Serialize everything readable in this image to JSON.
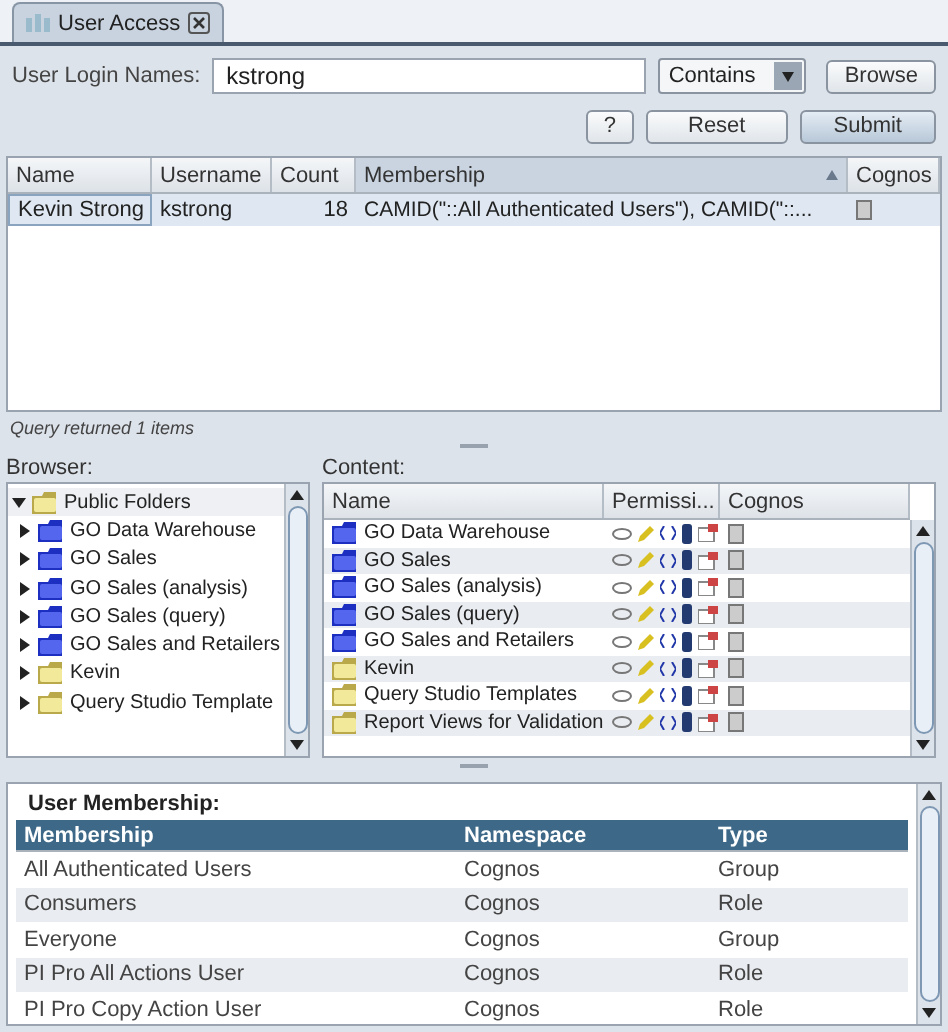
{
  "tabs": [
    {
      "label": "User Access",
      "selected": true
    }
  ],
  "search": {
    "label": "User Login Names:",
    "value": "kstrong",
    "match": "Contains",
    "browse": "Browse"
  },
  "actions": [
    "?",
    "Reset",
    "Submit"
  ],
  "results": {
    "columns": [
      {
        "label": "Name",
        "sorted": false
      },
      {
        "label": "Username",
        "sorted": false
      },
      {
        "label": "Count",
        "sorted": false
      },
      {
        "label": "Membership",
        "sorted": true
      },
      {
        "label": "Cognos",
        "sorted": false
      }
    ],
    "rows": [
      {
        "name": "Kevin Strong",
        "username": "kstrong",
        "count": "18",
        "membership": "CAMID(\"::All Authenticated Users\"), CAMID(\"::...",
        "selected": true
      }
    ]
  },
  "status": "Query returned  1 items",
  "browser": {
    "label": "Browser:",
    "root": {
      "label": "Public Folders",
      "expanded": true,
      "children": [
        {
          "label": "GO Data Warehouse",
          "kind": "package"
        },
        {
          "label": "GO Sales",
          "kind": "package"
        },
        {
          "label": "GO Sales (analysis)",
          "kind": "package"
        },
        {
          "label": "GO Sales (query)",
          "kind": "package"
        },
        {
          "label": "GO Sales and Retailers",
          "kind": "package"
        },
        {
          "label": "Kevin",
          "kind": "folder"
        },
        {
          "label": "Query Studio Template",
          "kind": "folder"
        }
      ]
    }
  },
  "content": {
    "label": "Content:",
    "columns": [
      "Name",
      "Permissi...",
      "Cognos"
    ],
    "rows": [
      {
        "name": "GO Data Warehouse",
        "kind": "package"
      },
      {
        "name": "GO Sales",
        "kind": "package"
      },
      {
        "name": "GO Sales (analysis)",
        "kind": "package"
      },
      {
        "name": "GO Sales (query)",
        "kind": "package"
      },
      {
        "name": "GO Sales and Retailers",
        "kind": "package"
      },
      {
        "name": "Kevin",
        "kind": "folder"
      },
      {
        "name": "Query Studio Templates",
        "kind": "folder"
      },
      {
        "name": "Report Views for Validation",
        "kind": "folder"
      }
    ]
  },
  "membership": {
    "title": "User Membership:",
    "columns": [
      "Membership",
      "Namespace",
      "Type"
    ],
    "rows": [
      {
        "membership": "All Authenticated Users",
        "namespace": "Cognos",
        "type": "Group"
      },
      {
        "membership": "Consumers",
        "namespace": "Cognos",
        "type": "Role"
      },
      {
        "membership": "Everyone",
        "namespace": "Cognos",
        "type": "Group"
      },
      {
        "membership": "PI Pro All Actions User",
        "namespace": "Cognos",
        "type": "Role"
      },
      {
        "membership": "PI Pro Copy Action User",
        "namespace": "Cognos",
        "type": "Role"
      }
    ]
  }
}
